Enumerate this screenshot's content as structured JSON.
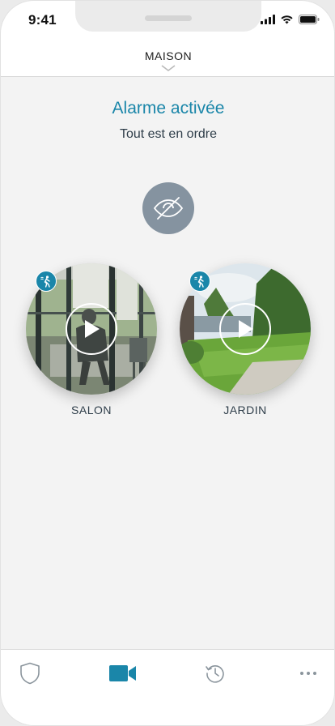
{
  "status_bar": {
    "time": "9:41",
    "icons": [
      "cellular-signal-icon",
      "wifi-icon",
      "battery-icon"
    ]
  },
  "header": {
    "title": "MAISON",
    "chevron_icon": "chevron-down-icon"
  },
  "alarm": {
    "title": "Alarme activée",
    "subtitle": "Tout est en ordre"
  },
  "privacy_button": {
    "icon": "eye-off-icon"
  },
  "cameras": [
    {
      "label": "SALON",
      "badge_icon": "motion-sensor-icon",
      "play_icon": "play-icon"
    },
    {
      "label": "JARDIN",
      "badge_icon": "motion-sensor-icon",
      "play_icon": "play-icon"
    }
  ],
  "tab_bar": {
    "tabs": [
      {
        "icon": "shield-icon",
        "active": false
      },
      {
        "icon": "video-camera-icon",
        "active": true
      },
      {
        "icon": "history-icon",
        "active": false
      },
      {
        "icon": "more-dots-icon",
        "active": false
      }
    ]
  },
  "colors": {
    "accent": "#1a86a9",
    "inactive_icon": "#8a949c",
    "privacy_button": "#8593a0",
    "text_dark": "#2e3d49",
    "background": "#f3f3f3"
  }
}
